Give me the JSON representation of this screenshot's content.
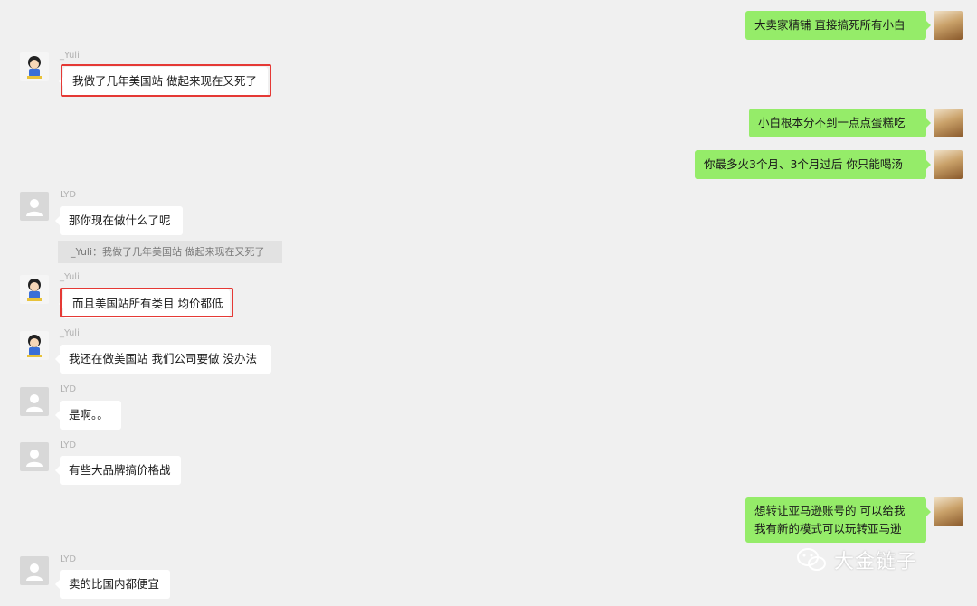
{
  "messages": [
    {
      "side": "right",
      "text": "大卖家精铺 直接搞死所有小白"
    },
    {
      "side": "left",
      "sender": "_Yuli",
      "text": "我做了几年美国站 做起来现在又死了",
      "highlighted": true
    },
    {
      "side": "right",
      "text": "小白根本分不到一点点蛋糕吃"
    },
    {
      "side": "right",
      "text": "你最多火3个月、3个月过后 你只能喝汤"
    },
    {
      "side": "left",
      "sender": "LYD",
      "text": "那你现在做什么了呢",
      "quote": "_Yuli：我做了几年美国站 做起来现在又死了"
    },
    {
      "side": "left",
      "sender": "_Yuli",
      "text": "而且美国站所有类目 均价都低",
      "highlighted": true
    },
    {
      "side": "left",
      "sender": "_Yuli",
      "text": "我还在做美国站 我们公司要做 没办法"
    },
    {
      "side": "left",
      "sender": "LYD",
      "text": "是啊。。"
    },
    {
      "side": "left",
      "sender": "LYD",
      "text": "有些大品牌搞价格战"
    },
    {
      "side": "right",
      "lines": [
        "想转让亚马逊账号的 可以给我",
        "我有新的模式可以玩转亚马逊"
      ]
    },
    {
      "side": "left",
      "sender": "LYD",
      "text": "卖的比国内都便宜"
    }
  ],
  "watermark": {
    "text": "大金链子",
    "icon": "wechat-official-account-icon"
  },
  "colors": {
    "background": "#f0f0f0",
    "self_bubble": "#95ec69",
    "other_bubble": "#ffffff",
    "highlight": "#e53935"
  }
}
